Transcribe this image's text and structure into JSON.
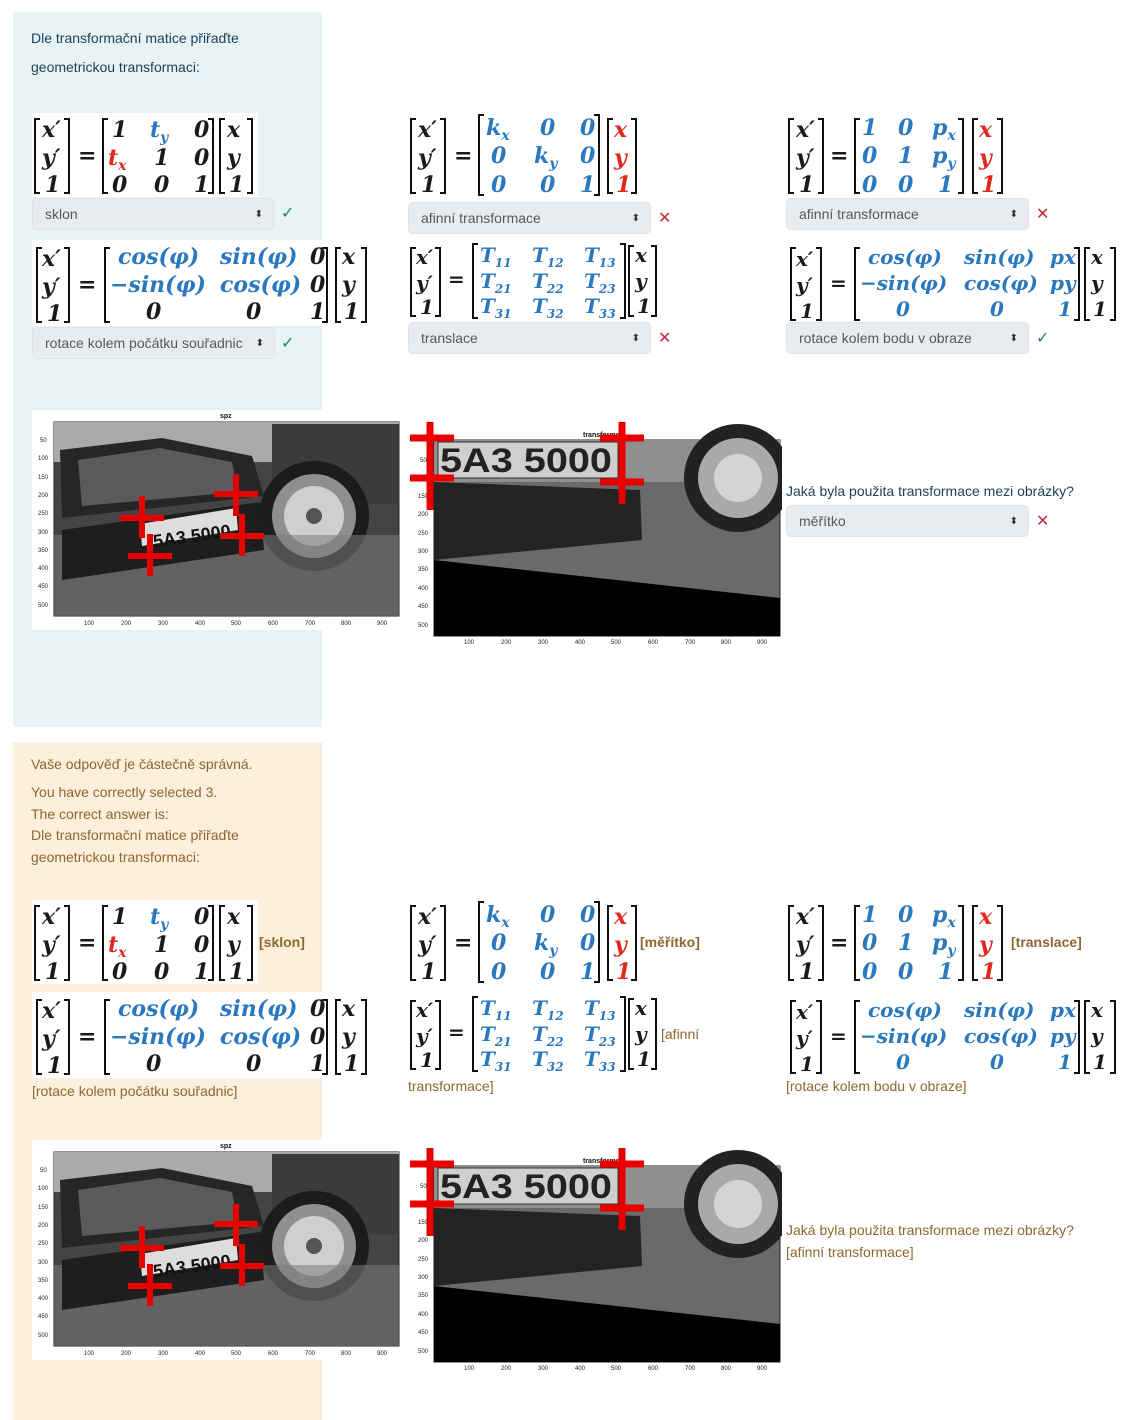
{
  "question": {
    "prompt_line1": "Dle transformační matice přiřaďte",
    "prompt_line2": "geometrickou transformaci:",
    "selects": [
      {
        "value": "sklon",
        "status": "correct"
      },
      {
        "value": "afinní transformace",
        "status": "incorrect"
      },
      {
        "value": "afinní transformace",
        "status": "incorrect"
      },
      {
        "value": "rotace kolem počátku souřadnic",
        "status": "correct"
      },
      {
        "value": "translace",
        "status": "incorrect"
      },
      {
        "value": "rotace kolem bodu v obraze",
        "status": "correct"
      },
      {
        "value": "měřítko",
        "status": "incorrect"
      }
    ],
    "image_question": "Jaká byla použita transformace mezi obrázky?"
  },
  "images": {
    "left_title": "spz",
    "right_title": "transformed",
    "plate_text": "5A3 5000",
    "y_ticks": [
      "50",
      "100",
      "150",
      "200",
      "250",
      "300",
      "350",
      "400",
      "450",
      "500"
    ],
    "x_ticks": [
      "100",
      "200",
      "300",
      "400",
      "500",
      "600",
      "700",
      "800",
      "900"
    ]
  },
  "matrices": {
    "m1": {
      "lhs": [
        "x′",
        "y′",
        "1"
      ],
      "rows": [
        [
          "1",
          "t_y",
          "0"
        ],
        [
          "t_x",
          "1",
          "0"
        ],
        [
          "0",
          "0",
          "1"
        ]
      ],
      "rhs": [
        "x",
        "y",
        "1"
      ]
    },
    "m2": {
      "lhs": [
        "x′",
        "y′",
        "1"
      ],
      "rows": [
        [
          "k_x",
          "0",
          "0"
        ],
        [
          "0",
          "k_y",
          "0"
        ],
        [
          "0",
          "0",
          "1"
        ]
      ],
      "rhs": [
        "x",
        "y",
        "1"
      ]
    },
    "m3": {
      "lhs": [
        "x′",
        "y′",
        "1"
      ],
      "rows": [
        [
          "1",
          "0",
          "p_x"
        ],
        [
          "0",
          "1",
          "p_y"
        ],
        [
          "0",
          "0",
          "1"
        ]
      ],
      "rhs": [
        "x",
        "y",
        "1"
      ]
    },
    "m4": {
      "lhs": [
        "x′",
        "y′",
        "1"
      ],
      "rows": [
        [
          "cos(φ)",
          "sin(φ)",
          "0"
        ],
        [
          "−sin(φ)",
          "cos(φ)",
          "0"
        ],
        [
          "0",
          "0",
          "1"
        ]
      ],
      "rhs": [
        "x",
        "y",
        "1"
      ]
    },
    "m5": {
      "lhs": [
        "x′",
        "y′",
        "1"
      ],
      "rows": [
        [
          "T11",
          "T12",
          "T13"
        ],
        [
          "T21",
          "T22",
          "T23"
        ],
        [
          "T31",
          "T32",
          "T33"
        ]
      ],
      "rhs": [
        "x",
        "y",
        "1"
      ]
    },
    "m6": {
      "lhs": [
        "x′",
        "y′",
        "1"
      ],
      "rows": [
        [
          "cos(φ)",
          "sin(φ)",
          "px"
        ],
        [
          "−sin(φ)",
          "cos(φ)",
          "py"
        ],
        [
          "0",
          "0",
          "1"
        ]
      ],
      "rhs": [
        "x",
        "y",
        "1"
      ]
    }
  },
  "feedback": {
    "partial": "Vaše odpověď je částečně správná.",
    "selected": "You have correctly selected 3.",
    "correct_is": "The correct answer is:",
    "prompt_line1": "Dle transformační matice přiřaďte",
    "prompt_line2": "geometrickou transformaci:",
    "answers": {
      "a1": "[sklon]",
      "a2": "[měřítko]",
      "a3": "[translace]",
      "a4": "[rotace kolem počátku souřadnic]",
      "a5_line1": "[afinní",
      "a5_line2": "transformace]",
      "a6": "[rotace kolem bodu v obraze]",
      "image_question": "Jaká byla použita transformace mezi obrázky?",
      "image_answer": "[afinní transformace]"
    }
  },
  "colors": {
    "question_bg": "#e7f3f5",
    "feedback_bg": "#fcefdc",
    "matrix_blue": "#2a78bd",
    "matrix_red": "#e0281f",
    "correct_green": "#1f8a4c",
    "incorrect_red": "#c4283a",
    "feedback_text": "#8e662e"
  }
}
